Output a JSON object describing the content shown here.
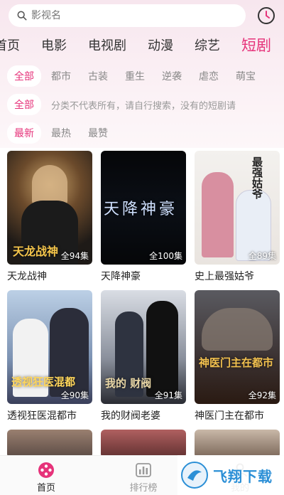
{
  "search": {
    "placeholder": "影视名"
  },
  "categories": [
    {
      "label": "首页"
    },
    {
      "label": "电影"
    },
    {
      "label": "电视剧"
    },
    {
      "label": "动漫"
    },
    {
      "label": "综艺"
    },
    {
      "label": "短剧",
      "active": true
    }
  ],
  "genres": [
    "全部",
    "都市",
    "古装",
    "重生",
    "逆袭",
    "虐恋",
    "萌宝"
  ],
  "filter_row": {
    "label": "全部",
    "note": "分类不代表所有，请自行搜索，没有的短剧请"
  },
  "sorts": [
    "最新",
    "最热",
    "最赞"
  ],
  "cards": [
    {
      "title": "天龙战神",
      "episodes": "全94集",
      "poster_text": "天龙战神"
    },
    {
      "title": "天降神豪",
      "episodes": "全100集",
      "poster_text": "天降神豪"
    },
    {
      "title": "史上最强姑爷",
      "episodes": "全89集",
      "poster_text": "最强姑爷"
    },
    {
      "title": "透视狂医混都市",
      "episodes": "全90集",
      "poster_text": "透视狂医混都"
    },
    {
      "title": "我的财阀老婆",
      "episodes": "全91集",
      "poster_text": "我的 财阀"
    },
    {
      "title": "神医门主在都市",
      "episodes": "全92集",
      "poster_text": "神医门主在都市"
    }
  ],
  "tabbar": [
    {
      "label": "首页",
      "icon": "film-reel-icon",
      "active": true
    },
    {
      "label": "排行榜",
      "icon": "bar-chart-icon"
    },
    {
      "label": "我的",
      "icon": "user-icon"
    }
  ],
  "watermark": {
    "text": "飞翔下载"
  },
  "colors": {
    "accent": "#e6337a",
    "header_bg": "#f7e6ee"
  }
}
